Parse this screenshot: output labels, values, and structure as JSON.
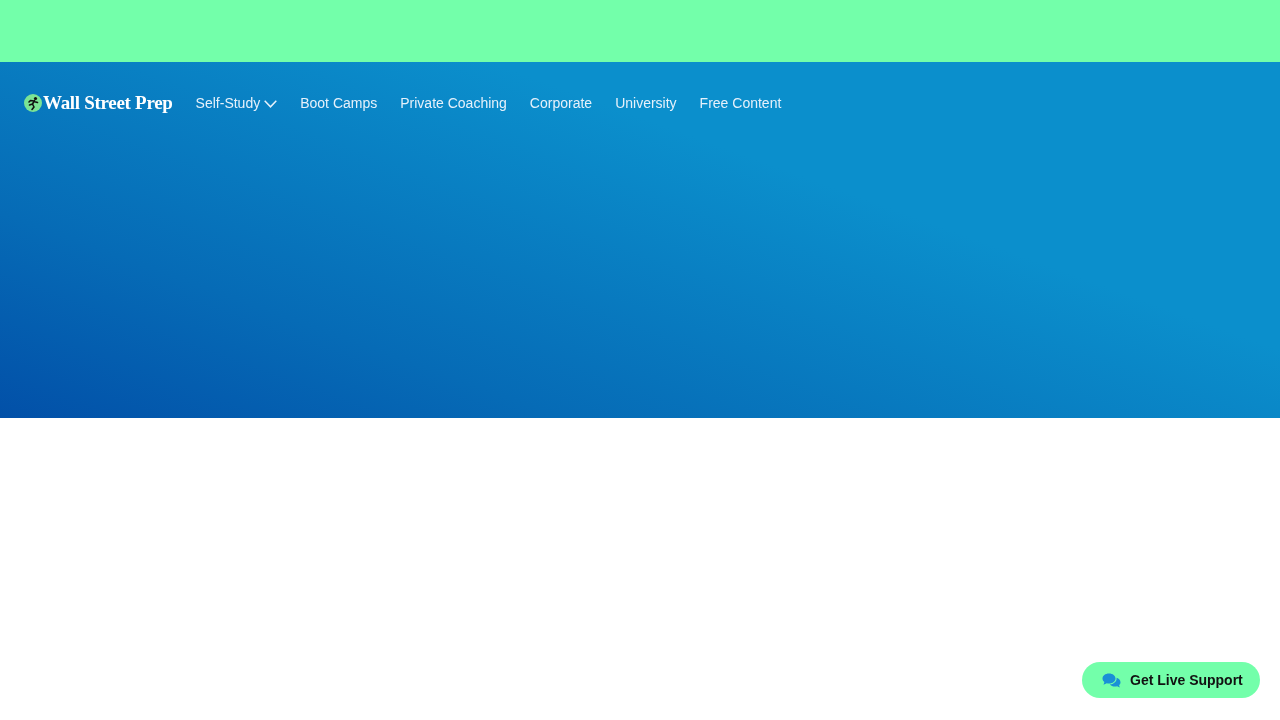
{
  "header": {
    "logo": "Wall Street Prep",
    "nav": [
      {
        "label": "Self-Study",
        "kind": "dropdown"
      },
      {
        "label": "Boot Camps",
        "kind": "link"
      },
      {
        "label": "Private Coaching",
        "kind": "link"
      },
      {
        "label": "Corporate",
        "kind": "link"
      },
      {
        "label": "University",
        "kind": "link"
      },
      {
        "label": "Free Content",
        "kind": "link"
      }
    ]
  },
  "chat_button": {
    "label": "Get Live Support"
  }
}
